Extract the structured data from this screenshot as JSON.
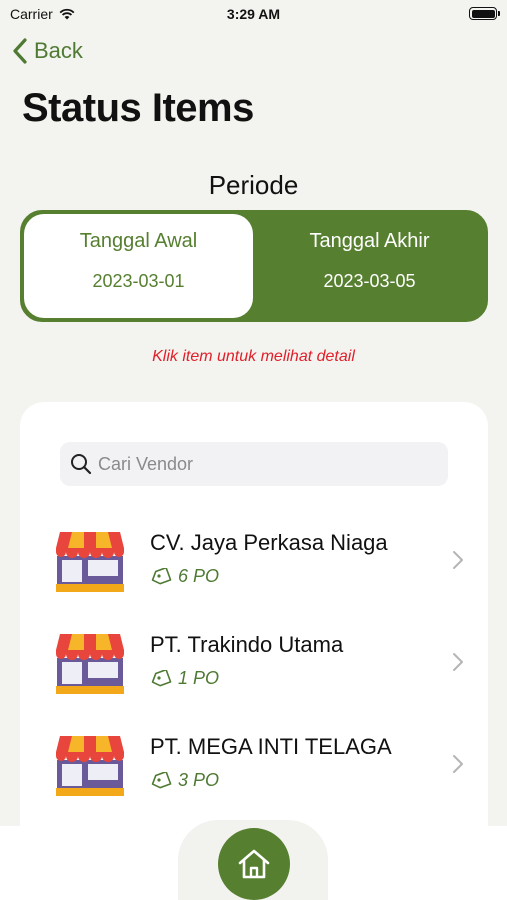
{
  "status_bar": {
    "carrier": "Carrier",
    "time": "3:29 AM"
  },
  "nav": {
    "back_label": "Back"
  },
  "page": {
    "title": "Status Items"
  },
  "period": {
    "heading": "Periode",
    "start_label": "Tanggal Awal",
    "start_date": "2023-03-01",
    "end_label": "Tanggal Akhir",
    "end_date": "2023-03-05",
    "selected": "start"
  },
  "hint": "Klik item untuk melihat detail",
  "search": {
    "placeholder": "Cari Vendor",
    "value": ""
  },
  "vendors": [
    {
      "name": "CV. Jaya Perkasa Niaga",
      "po": "6 PO"
    },
    {
      "name": "PT. Trakindo Utama",
      "po": "1 PO"
    },
    {
      "name": "PT. MEGA INTI TELAGA",
      "po": "3 PO"
    }
  ],
  "colors": {
    "accent": "#567f30",
    "hint": "#e0202a",
    "background": "#f3f3ef"
  },
  "icons": {
    "back": "chevron-left-icon",
    "search": "search-icon",
    "vendor": "shop-icon",
    "po": "tag-icon",
    "row": "chevron-right-icon",
    "home": "home-icon"
  }
}
